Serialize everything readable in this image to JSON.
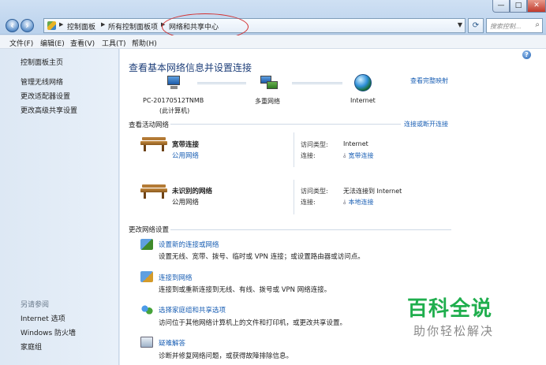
{
  "address_bar": {
    "crumbs": [
      "控制面板",
      "所有控制面板项",
      "网络和共享中心"
    ],
    "search_placeholder": "搜索控制..."
  },
  "window_controls": {
    "minimize": "—",
    "maximize": "□",
    "close": "✕"
  },
  "menu": [
    "文件(F)",
    "编辑(E)",
    "查看(V)",
    "工具(T)",
    "帮助(H)"
  ],
  "sidebar": {
    "top_links": [
      "控制面板主页",
      "管理无线网络",
      "更改适配器设置",
      "更改高级共享设置"
    ],
    "see_also_heading": "另请参阅",
    "see_also_links": [
      "Internet 选项",
      "Windows 防火墙",
      "家庭组"
    ]
  },
  "main": {
    "title": "查看基本网络信息并设置连接",
    "full_map_link": "查看完整映射",
    "nodes": {
      "pc_name": "PC-20170512TNMB",
      "pc_sub": "(此计算机)",
      "middle": "多重网络",
      "internet": "Internet"
    },
    "active_networks_heading": "查看活动网络",
    "connect_link": "连接或断开连接",
    "networks": [
      {
        "name": "宽带连接",
        "type": "公用网络",
        "access_label": "访问类型:",
        "access_value": "Internet",
        "conn_label": "连接:",
        "conn_value": "宽带连接"
      },
      {
        "name": "未识别的网络",
        "type": "公用网络",
        "access_label": "访问类型:",
        "access_value": "无法连接到 Internet",
        "conn_label": "连接:",
        "conn_value": "本地连接"
      }
    ],
    "change_settings_heading": "更改网络设置",
    "tasks": [
      {
        "link": "设置新的连接或网络",
        "desc": "设置无线、宽带、拨号、临时或 VPN 连接；或设置路由器或访问点。"
      },
      {
        "link": "连接到网络",
        "desc": "连接到或重新连接到无线、有线、拨号或 VPN 网络连接。"
      },
      {
        "link": "选择家庭组和共享选项",
        "desc": "访问位于其他网络计算机上的文件和打印机，或更改共享设置。"
      },
      {
        "link": "疑难解答",
        "desc": "诊断并修复网络问题，或获得故障排除信息。"
      }
    ]
  },
  "watermark": {
    "logo": "百科全说",
    "sub": "助你轻松解决"
  },
  "colors": {
    "link": "#1a5fb4",
    "title": "#1e3f7a",
    "annotation": "#d32f2f",
    "watermark": "#1fae4d"
  }
}
